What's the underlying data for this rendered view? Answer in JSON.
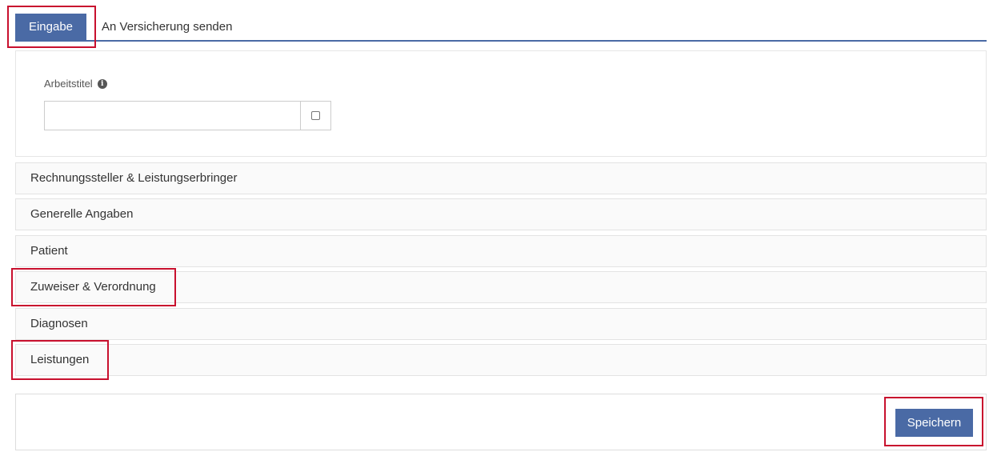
{
  "tabs": [
    {
      "label": "Eingabe",
      "active": true
    },
    {
      "label": "An Versicherung senden",
      "active": false
    }
  ],
  "form": {
    "arbeitstitel_label": "Arbeitstitel",
    "arbeitstitel_value": ""
  },
  "sections": [
    {
      "label": "Rechnungssteller & Leistungserbringer"
    },
    {
      "label": "Generelle Angaben"
    },
    {
      "label": "Patient"
    },
    {
      "label": "Zuweiser & Verordnung"
    },
    {
      "label": "Diagnosen"
    },
    {
      "label": "Leistungen"
    }
  ],
  "footer": {
    "save_label": "Speichern"
  },
  "colors": {
    "accent": "#4a6aa5",
    "highlight": "#c8102e"
  },
  "icons": {
    "info": "info-circle-icon",
    "checkbox": "checkbox-icon"
  }
}
